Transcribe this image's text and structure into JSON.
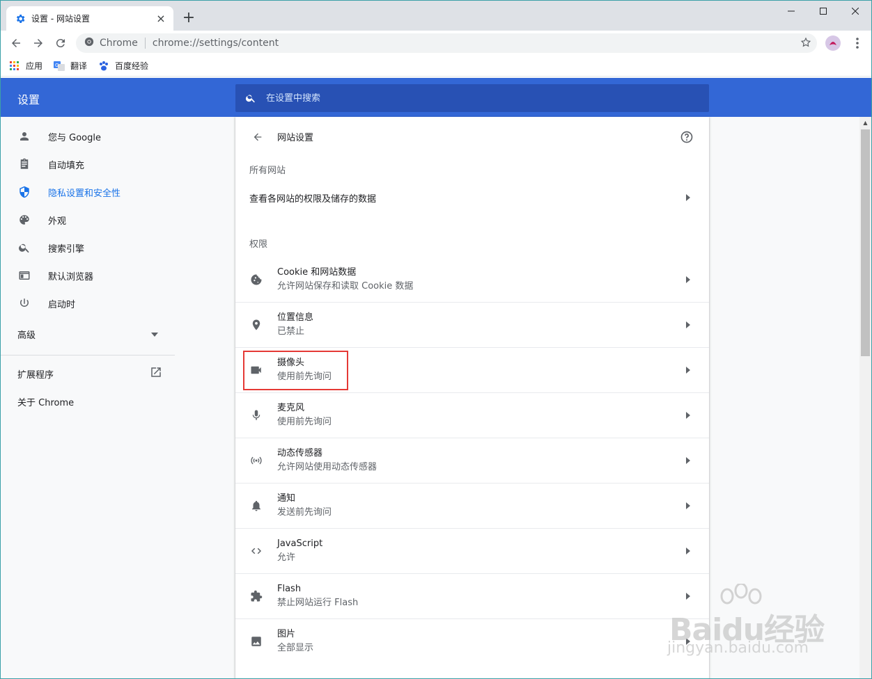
{
  "browser": {
    "tab_title": "设置 - 网站设置",
    "omnibox_site": "Chrome",
    "omnibox_url": "chrome://settings/content",
    "bookmarks": [
      "应用",
      "翻译",
      "百度经验"
    ]
  },
  "header": {
    "title": "设置",
    "search_placeholder": "在设置中搜索"
  },
  "sidebar": {
    "items": [
      {
        "label": "您与 Google",
        "icon": "person-icon"
      },
      {
        "label": "自动填充",
        "icon": "clipboard-icon"
      },
      {
        "label": "隐私设置和安全性",
        "icon": "shield-icon"
      },
      {
        "label": "外观",
        "icon": "palette-icon"
      },
      {
        "label": "搜索引擎",
        "icon": "search-icon"
      },
      {
        "label": "默认浏览器",
        "icon": "browser-icon"
      },
      {
        "label": "启动时",
        "icon": "power-icon"
      }
    ],
    "advanced": "高级",
    "extensions": "扩展程序",
    "about": "关于 Chrome"
  },
  "main": {
    "title": "网站设置",
    "section_all": "所有网站",
    "all_sites_row": "查看各网站的权限及储存的数据",
    "section_permissions": "权限",
    "permissions": [
      {
        "title": "Cookie 和网站数据",
        "subtitle": "允许网站保存和读取 Cookie 数据",
        "icon": "cookie-icon"
      },
      {
        "title": "位置信息",
        "subtitle": "已禁止",
        "icon": "location-icon"
      },
      {
        "title": "摄像头",
        "subtitle": "使用前先询问",
        "icon": "camera-icon"
      },
      {
        "title": "麦克风",
        "subtitle": "使用前先询问",
        "icon": "microphone-icon"
      },
      {
        "title": "动态传感器",
        "subtitle": "允许网站使用动态传感器",
        "icon": "sensor-icon"
      },
      {
        "title": "通知",
        "subtitle": "发送前先询问",
        "icon": "bell-icon"
      },
      {
        "title": "JavaScript",
        "subtitle": "允许",
        "icon": "code-icon"
      },
      {
        "title": "Flash",
        "subtitle": "禁止网站运行 Flash",
        "icon": "puzzle-icon"
      },
      {
        "title": "图片",
        "subtitle": "全部显示",
        "icon": "image-icon"
      }
    ]
  },
  "watermark": {
    "logo": "Baidu经验",
    "url": "jingyan.baidu.com"
  },
  "colors": {
    "accent": "#3367d6",
    "search_bg": "#2851b4",
    "active_link": "#1a73e8",
    "highlight": "#e53935"
  }
}
